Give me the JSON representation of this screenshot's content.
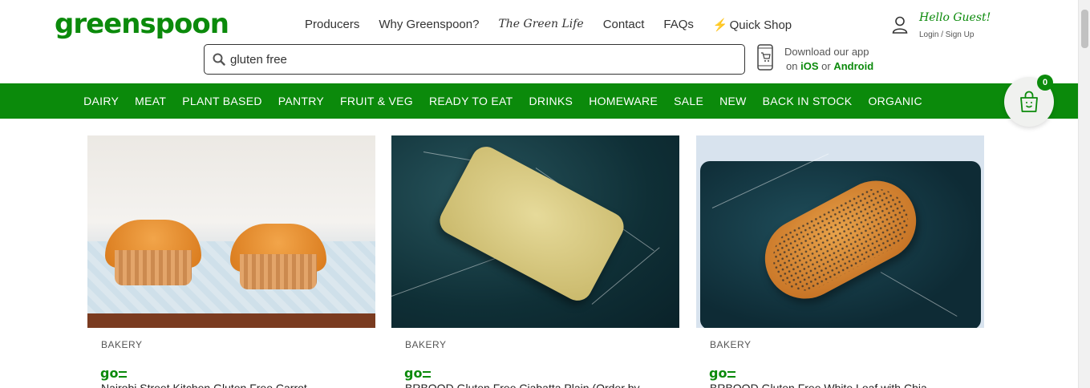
{
  "header": {
    "logo": "greenspoon",
    "nav": [
      "Producers",
      "Why Greenspoon?",
      "The Green Life",
      "Contact",
      "FAQs",
      "Quick Shop"
    ],
    "greeting": "Hello Guest!",
    "login": "Login / Sign Up"
  },
  "search": {
    "value": "gluten free",
    "placeholder": ""
  },
  "app": {
    "line1": "Download our app",
    "on": "on",
    "ios": "iOS",
    "or": "or",
    "android": "Android"
  },
  "categories": [
    "DAIRY",
    "MEAT",
    "PLANT BASED",
    "PANTRY",
    "FRUIT & VEG",
    "READY TO EAT",
    "DRINKS",
    "HOMEWARE",
    "SALE",
    "NEW",
    "BACK IN STOCK",
    "ORGANIC"
  ],
  "cart": {
    "count": "0"
  },
  "products": [
    {
      "category": "BAKERY",
      "badge": "go",
      "name": "Nairobi Street Kitchen Gluten Free Carrot"
    },
    {
      "category": "BAKERY",
      "badge": "go",
      "name": "BRBOOD Gluten Free Ciabatta Plain (Order by"
    },
    {
      "category": "BAKERY",
      "badge": "go",
      "name": "BRBOOD Gluten Free White Loaf with Chia"
    }
  ],
  "colors": {
    "brand": "#0b8a0b"
  }
}
